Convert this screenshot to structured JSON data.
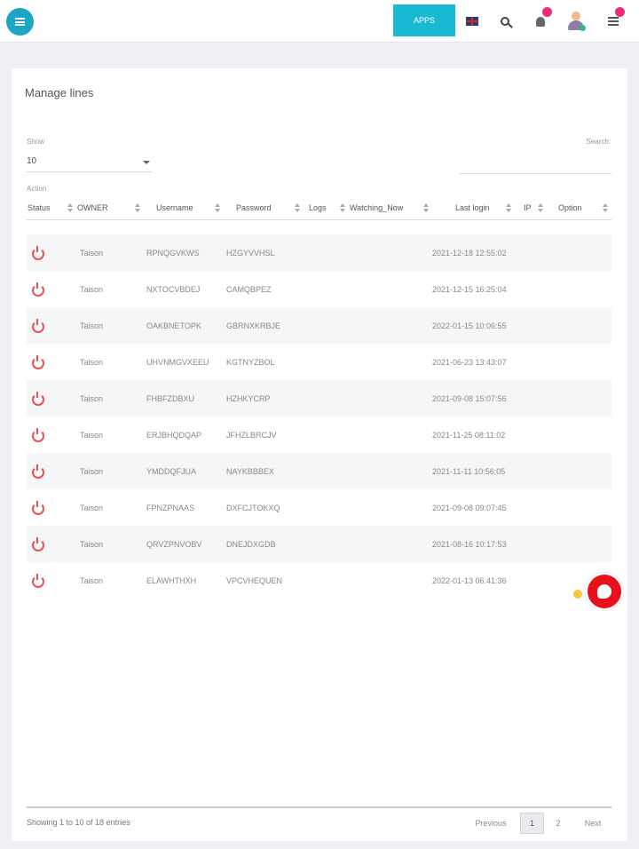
{
  "header": {
    "cta_label": "APPS",
    "colors": {
      "primary": "#1ba7c4",
      "cta": "#19b8d3",
      "badge": "#ef2a7b"
    }
  },
  "page": {
    "title": "Manage lines"
  },
  "controls": {
    "show_label": "Show",
    "show_value": "10",
    "search_label": "Search:",
    "action_label": "Action"
  },
  "table": {
    "columns": [
      "Status",
      "OWNER",
      "Username",
      "Password",
      "Logs",
      "Watching_Now",
      "Last login",
      "IP",
      "Option"
    ],
    "rows": [
      {
        "owner": "Taison",
        "username": "RPNQGVKWS",
        "password": "HZGYVVHSL",
        "last_login": "2021-12-18 12:55:02"
      },
      {
        "owner": "Taison",
        "username": "NXTOCVBDEJ",
        "password": "CAMQBPEZ",
        "last_login": "2021-12-15 16:25:04"
      },
      {
        "owner": "Taison",
        "username": "OAKBNETOPK",
        "password": "GBRNXKRBJE",
        "last_login": "2022-01-15 10:06:55"
      },
      {
        "owner": "Taison",
        "username": "UHVNMGVXEEU",
        "password": "KGTNYZBOL",
        "last_login": "2021-06-23 13:43:07"
      },
      {
        "owner": "Taison",
        "username": "FHBFZDBXU",
        "password": "HZHKYCRP",
        "last_login": "2021-09-08 15:07:56"
      },
      {
        "owner": "Taison",
        "username": "ERJBHQDQAP",
        "password": "JFHZLBRCJV",
        "last_login": "2021-11-25 08:11:02"
      },
      {
        "owner": "Taison",
        "username": "YMDDQFJUA",
        "password": "NAYKBBBEX",
        "last_login": "2021-11-11 10:56:05"
      },
      {
        "owner": "Taison",
        "username": "FPNZPNAAS",
        "password": "DXFCJTOKXQ",
        "last_login": "2021-09-08 09:07:45"
      },
      {
        "owner": "Taison",
        "username": "QRVZPNVOBV",
        "password": "DNEJDXGDB",
        "last_login": "2021-08-16 10:17:53"
      },
      {
        "owner": "Taison",
        "username": "ELAWHTHXH",
        "password": "VPCVHEQUEN",
        "last_login": "2022-01-13 06:41:36"
      }
    ]
  },
  "footer": {
    "info": "Showing 1 to 10 of 18 entries",
    "previous": "Previous",
    "page1": "1",
    "page2": "2",
    "next": "Next"
  }
}
